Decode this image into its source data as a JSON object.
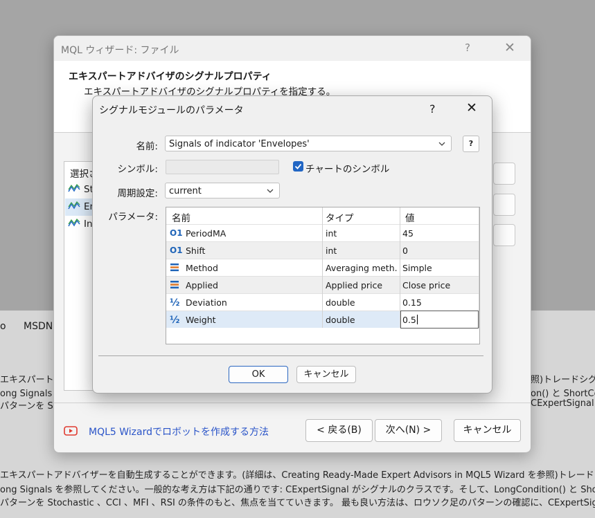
{
  "background": {
    "tabs": [
      "o",
      "MSDN"
    ],
    "lines_mid": [
      {
        "left": "エキスパートアド",
        "right": "照)トレードシグナル"
      },
      {
        "left": "ong Signals を",
        "right": "on() と ShortCo"
      },
      {
        "left": "パターンを Sto",
        "right": "CExpertSignal"
      }
    ],
    "lines_bottom": [
      "エキスパートアドバイザーを自動生成することができます。(詳細は、Creating Ready-Made Expert Advisors in MQL5 Wizard を参照)トレードシグナル",
      "ong Signals を参照してください。一般的な考え方は下記の通りです: CExpertSignal がシグナルのクラスです。そして、LongCondition() と ShortCon",
      "パターンを Stochastic 、CCI 、MFI 、RSI の条件のもと、焦点を当てていきます。 最も良い方法は、ロウソク足のパターンの確認に、CExpertSignal"
    ]
  },
  "wizard": {
    "title": "MQL ウィザード: ファイル",
    "help": "?",
    "close": "✕",
    "header_title": "エキスパートアドバイザのシグナルプロパティ",
    "header_subtitle": "エキスパートアドバイザのシグナルプロパティを指定する。",
    "list_header": "選択さ",
    "list_items": [
      {
        "label": "St"
      },
      {
        "label": "En"
      },
      {
        "label": "In"
      }
    ],
    "video_link": "MQL5 Wizardでロボットを作成する方法",
    "back_button": "< 戻る(B)",
    "next_button": "次へ(N) >",
    "cancel_button": "キャンセル"
  },
  "dialog": {
    "title": "シグナルモジュールのパラメータ",
    "help": "?",
    "close": "✕",
    "name_label": "名前:",
    "name_value": "Signals of indicator 'Envelopes'",
    "help_button": "?",
    "symbol_label": "シンボル:",
    "chart_symbol_label": "チャートのシンボル",
    "chart_symbol_checked": true,
    "period_label": "周期設定:",
    "period_value": "current",
    "params_label": "パラメータ:",
    "grid": {
      "headers": [
        "名前",
        "タイプ",
        "値"
      ],
      "rows": [
        {
          "icon": "O1",
          "name": "PeriodMA",
          "type": "int",
          "value": "45"
        },
        {
          "icon": "O1",
          "name": "Shift",
          "type": "int",
          "value": "0"
        },
        {
          "icon": "enum",
          "name": "Method",
          "type": "Averaging meth...",
          "value": "Simple"
        },
        {
          "icon": "enum",
          "name": "Applied",
          "type": "Applied price",
          "value": "Close price"
        },
        {
          "icon": "½",
          "name": "Deviation",
          "type": "double",
          "value": "0.15"
        },
        {
          "icon": "½",
          "name": "Weight",
          "type": "double",
          "value": "0.5"
        }
      ]
    },
    "ok_button": "OK",
    "cancel_button": "キャンセル"
  },
  "colors": {
    "accent": "#2166c4",
    "link": "#2a54c8",
    "selection": "#deeaf7",
    "youtube_red": "#e03a2f"
  }
}
